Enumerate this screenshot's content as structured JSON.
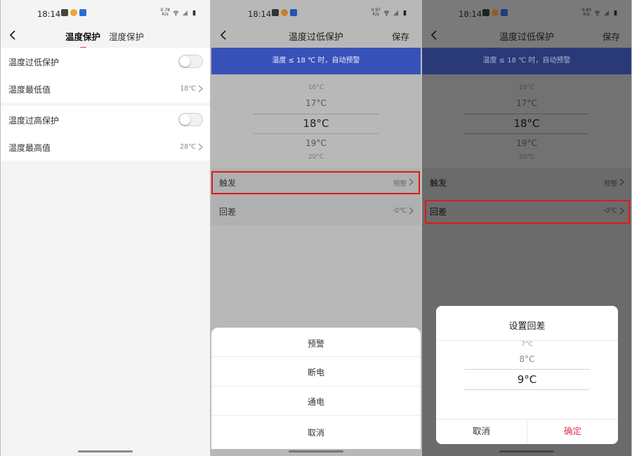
{
  "status_bar": {
    "time": "18:14",
    "speed_1": "0.78",
    "speed_2": "0.97",
    "speed_3": "0.60",
    "speed_unit": "K/s"
  },
  "screen1": {
    "tabs": [
      {
        "label": "温度保护",
        "active": true
      },
      {
        "label": "湿度保护",
        "active": false
      }
    ],
    "rows": [
      {
        "label": "温度过低保护",
        "type": "toggle"
      },
      {
        "label": "温度最低值",
        "value": "18℃"
      },
      {
        "label": "温度过高保护",
        "type": "toggle"
      },
      {
        "label": "温度最高值",
        "value": "28℃"
      }
    ]
  },
  "screen2": {
    "title": "温度过低保护",
    "save": "保存",
    "banner": "温度 ≤ 18 ℃ 时，自动预警",
    "picker": [
      "16°C",
      "17°C",
      "18°C",
      "19°C",
      "20°C"
    ],
    "trigger_label": "触发",
    "trigger_value": "预警",
    "hysteresis_label": "回差",
    "hysteresis_value": "-0℃",
    "sheet_options": [
      "预警",
      "断电",
      "通电",
      "取消"
    ]
  },
  "screen3": {
    "title": "温度过低保护",
    "save": "保存",
    "banner": "温度 ≤ 18 ℃ 时，自动预警",
    "picker": [
      "16°C",
      "17°C",
      "18°C",
      "19°C",
      "20°C"
    ],
    "trigger_label": "触发",
    "trigger_value": "预警",
    "hysteresis_label": "回差",
    "hysteresis_value": "-0℃",
    "dialog": {
      "title": "设置回差",
      "picker": [
        "7°C",
        "8°C",
        "9°C"
      ],
      "cancel": "取消",
      "confirm": "确定"
    }
  },
  "colors": {
    "accent_red": "#e0384d",
    "banner_blue": "#3851b8",
    "highlight_red": "#e01a1a"
  },
  "icons": [
    "back-arrow-icon",
    "chevron-right-icon",
    "wifi-icon",
    "signal-icon",
    "battery-icon",
    "gallery-icon",
    "app-icon"
  ]
}
